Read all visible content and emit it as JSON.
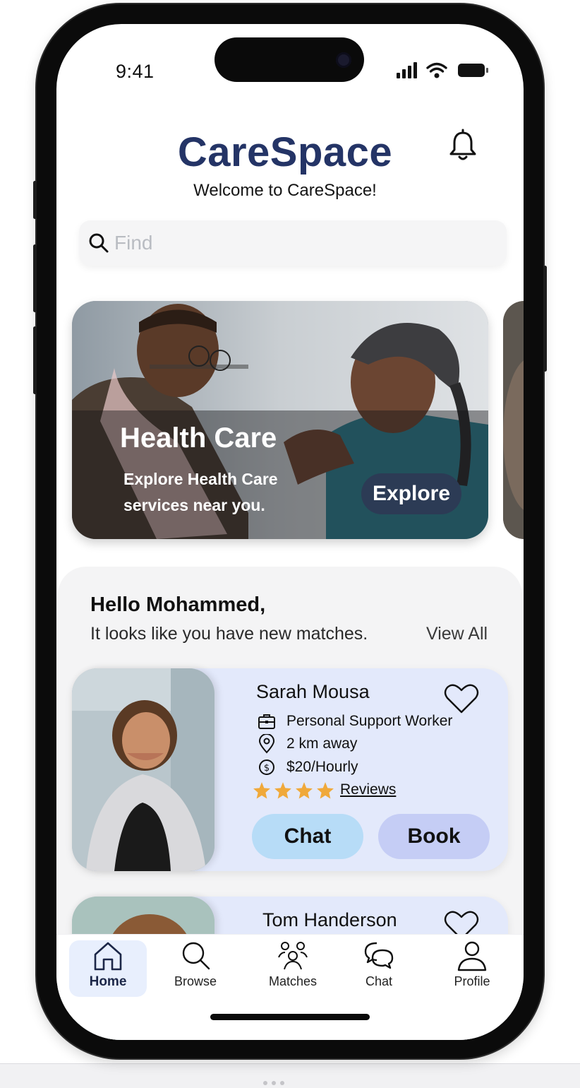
{
  "status_bar": {
    "time": "9:41"
  },
  "header": {
    "app_title": "CareSpace",
    "welcome": "Welcome to CareSpace!",
    "bell_icon": "bell-icon"
  },
  "search": {
    "placeholder": "Find",
    "icon": "search-icon"
  },
  "banner": {
    "title": "Health Care",
    "subtitle": "Explore Health Care services near you.",
    "button_label": "Explore"
  },
  "matches": {
    "greeting": "Hello Mohammed,",
    "subtitle": "It looks like you have new matches.",
    "view_all": "View All",
    "cards": [
      {
        "name": "Sarah Mousa",
        "role": "Personal Support Worker",
        "distance": "2 km away",
        "rate": "$20/Hourly",
        "stars": 4,
        "reviews_label": "Reviews",
        "chat_label": "Chat",
        "book_label": "Book"
      },
      {
        "name": "Tom Handerson"
      }
    ]
  },
  "tabbar": {
    "tabs": [
      {
        "label": "Home",
        "icon": "home-icon",
        "active": true
      },
      {
        "label": "Browse",
        "icon": "search-icon"
      },
      {
        "label": "Matches",
        "icon": "people-icon"
      },
      {
        "label": "Chat",
        "icon": "chat-bubbles-icon"
      },
      {
        "label": "Profile",
        "icon": "person-icon"
      }
    ]
  },
  "colors": {
    "brand": "#243466",
    "card_bg": "#e3e9fb",
    "chat_button": "#b7dcf7",
    "book_button": "#c5cdf5",
    "star": "#f0a93a",
    "explore_button": "#2c3b55"
  }
}
